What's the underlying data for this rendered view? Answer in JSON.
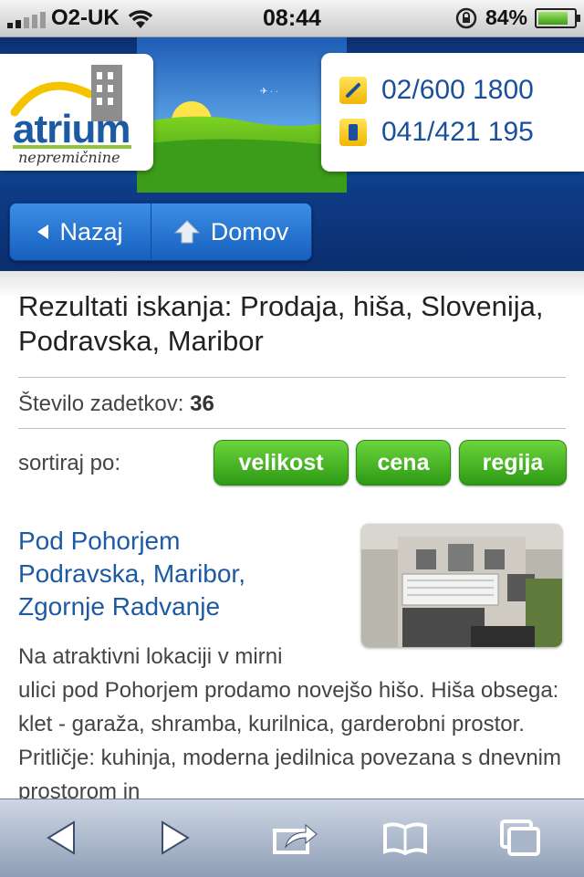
{
  "status_bar": {
    "carrier": "O2-UK",
    "time": "08:44",
    "battery": "84%",
    "battery_level": 0.84
  },
  "header": {
    "logo_name": "atrium",
    "logo_tagline": "nepremičnine",
    "phones": [
      "02/600 1800",
      "041/421 195"
    ]
  },
  "nav": {
    "back_label": "Nazaj",
    "home_label": "Domov"
  },
  "results": {
    "title": "Rezultati iskanja: Prodaja, hiša, Slovenija, Podravska, Maribor",
    "count_label": "Število zadetkov:",
    "count": "36",
    "sort_label": "sortiraj po:",
    "sort_buttons": [
      "velikost",
      "cena",
      "regija"
    ]
  },
  "listing": {
    "title_lines": [
      "Pod Pohorjem",
      "Podravska, Maribor,",
      "Zgornje Radvanje"
    ],
    "desc_first": "Na atraktivni lokaciji v mirni",
    "desc_rest": "ulici pod Pohorjem prodamo novejšo hišo. Hiša obsega: klet - garaža, shramba, kurilnica, garderobni prostor. Pritličje: kuhinja, moderna jedilnica povezana s dnevnim prostorom in"
  },
  "toolbar": {
    "icons": [
      "back-arrow-icon",
      "forward-arrow-icon",
      "share-icon",
      "bookmarks-icon",
      "tabs-icon"
    ]
  },
  "colors": {
    "accent_blue": "#1d5aa3",
    "sort_green": "#2e9a14",
    "header_blue": "#0b3b82"
  }
}
